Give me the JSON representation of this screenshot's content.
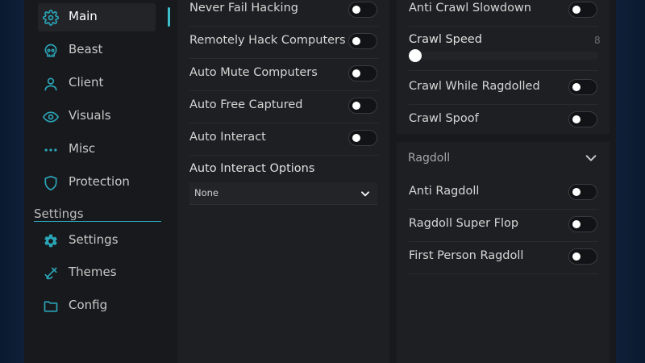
{
  "sidebar": {
    "items": [
      {
        "label": "Main",
        "icon": "gear-icon",
        "active": true
      },
      {
        "label": "Beast",
        "icon": "skull-icon"
      },
      {
        "label": "Client",
        "icon": "user-icon"
      },
      {
        "label": "Visuals",
        "icon": "eye-icon"
      },
      {
        "label": "Misc",
        "icon": "more-dots-icon"
      },
      {
        "label": "Protection",
        "icon": "shield-icon"
      }
    ],
    "section_label": "Settings",
    "settings_items": [
      {
        "label": "Settings",
        "icon": "settings-gear-icon"
      },
      {
        "label": "Themes",
        "icon": "brush-icon"
      },
      {
        "label": "Config",
        "icon": "folder-icon"
      }
    ]
  },
  "left_panel": {
    "toggles": [
      {
        "label": "Never Fail Hacking",
        "on": false
      },
      {
        "label": "Remotely Hack Computers",
        "on": false
      },
      {
        "label": "Auto Mute Computers",
        "on": false
      },
      {
        "label": "Auto Free Captured",
        "on": false
      },
      {
        "label": "Auto Interact",
        "on": false
      }
    ],
    "options_label": "Auto Interact Options",
    "options_value": "None"
  },
  "right_panel": {
    "anti_crawl_label": "Anti Crawl Slowdown",
    "crawl_speed": {
      "label": "Crawl Speed",
      "value": "8",
      "fraction": 0.0
    },
    "toggles": [
      {
        "label": "Crawl While Ragdolled",
        "on": false
      },
      {
        "label": "Crawl Spoof",
        "on": false
      }
    ]
  },
  "ragdoll_section": {
    "title": "Ragdoll",
    "toggles": [
      {
        "label": "Anti Ragdoll",
        "on": false
      },
      {
        "label": "Ragdoll Super Flop",
        "on": false
      },
      {
        "label": "First Person Ragdoll",
        "on": false
      }
    ]
  },
  "colors": {
    "accent": "#3bc0cc",
    "icon": "#2aa5b8",
    "background": "#18191c",
    "panel": "#1e1f22"
  }
}
